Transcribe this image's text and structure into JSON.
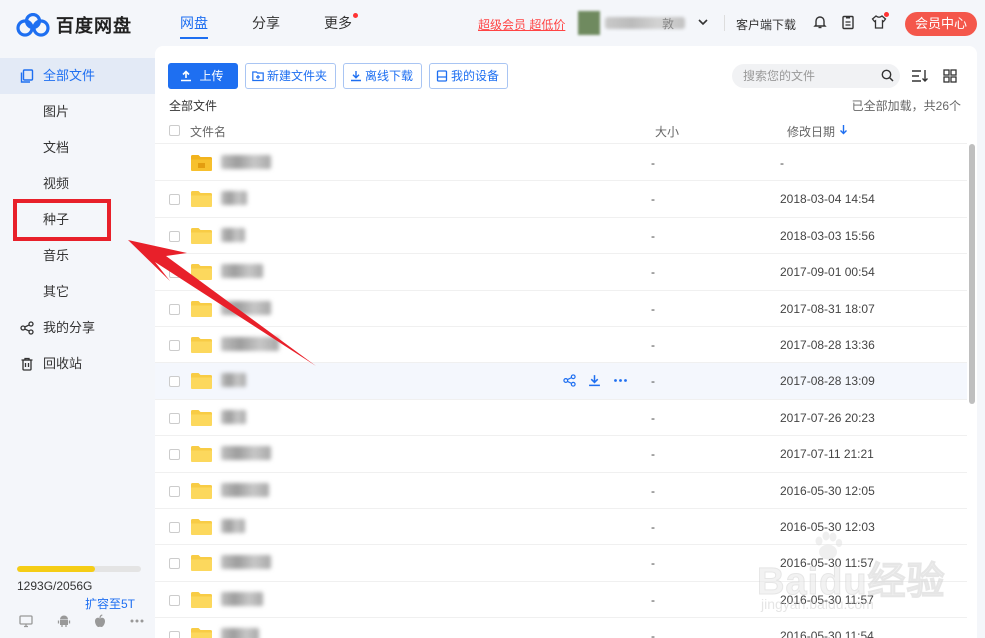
{
  "app": {
    "name": "百度网盘",
    "brand_color": "#1e6ff1",
    "accent_red": "#f4574b",
    "quota_color": "#f5cd16"
  },
  "topnav": {
    "items": [
      {
        "label": "网盘",
        "active": true,
        "dot": false
      },
      {
        "label": "分享",
        "active": false,
        "dot": false
      },
      {
        "label": "更多",
        "active": false,
        "dot": true
      }
    ]
  },
  "header": {
    "vip_promo": "超级会员 超低价",
    "username_suffix": "敦",
    "client_download": "客户端下载",
    "vip_center": "会员中心",
    "icons": [
      "bell-icon",
      "clipboard-icon",
      "shirt-icon"
    ]
  },
  "sidebar": {
    "items": [
      {
        "label": "全部文件",
        "icon": "files-icon",
        "active": true
      },
      {
        "label": "图片"
      },
      {
        "label": "文档"
      },
      {
        "label": "视频"
      },
      {
        "label": "种子"
      },
      {
        "label": "音乐"
      },
      {
        "label": "其它"
      },
      {
        "label": "我的分享",
        "icon": "share-icon"
      },
      {
        "label": "回收站",
        "icon": "trash-icon"
      }
    ],
    "quota": {
      "text": "1293G/2056G",
      "used": 1293,
      "total": 2056,
      "expand": "扩容至5T"
    },
    "devices": [
      "desktop-icon",
      "android-icon",
      "apple-icon",
      "more-icon"
    ]
  },
  "toolbar": {
    "upload": "上传",
    "new_folder": "新建文件夹",
    "offline_download": "离线下载",
    "my_devices": "我的设备",
    "search_placeholder": "搜索您的文件"
  },
  "list": {
    "breadcrumb": "全部文件",
    "loaded_text": "已全部加载，共26个",
    "col_name": "文件名",
    "col_size": "大小",
    "col_date": "修改日期",
    "sort": "descending",
    "rows": [
      {
        "size": "-",
        "date": "-"
      },
      {
        "size": "-",
        "date": "2018-03-04 14:54"
      },
      {
        "size": "-",
        "date": "2018-03-03 15:56"
      },
      {
        "size": "-",
        "date": "2017-09-01 00:54"
      },
      {
        "size": "-",
        "date": "2017-08-31 18:07"
      },
      {
        "size": "-",
        "date": "2017-08-28 13:36"
      },
      {
        "size": "-",
        "date": "2017-08-28 13:09",
        "hover": true
      },
      {
        "size": "-",
        "date": "2017-07-26 20:23"
      },
      {
        "size": "-",
        "date": "2017-07-11 21:21"
      },
      {
        "size": "-",
        "date": "2016-05-30 12:05"
      },
      {
        "size": "-",
        "date": "2016-05-30 12:03"
      },
      {
        "size": "-",
        "date": "2016-05-30 11:57"
      },
      {
        "size": "-",
        "date": "2016-05-30 11:57"
      },
      {
        "size": "-",
        "date": "2016-05-30 11:54"
      }
    ]
  },
  "watermark": {
    "main": "Baidu经验",
    "sub": "jingyan.baidu.com"
  }
}
